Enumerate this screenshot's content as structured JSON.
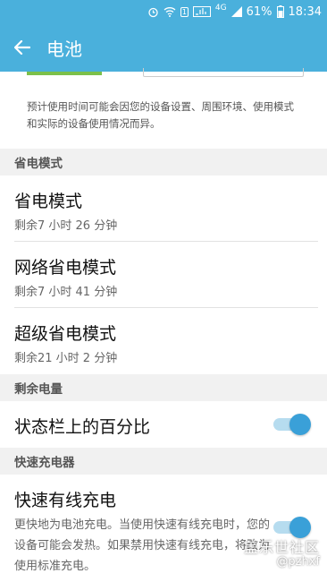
{
  "status_bar": {
    "network_label": "4G",
    "battery_percent": "61%",
    "time": "18:34",
    "sim_label": "1",
    "signal_label": "4G"
  },
  "app_bar": {
    "title": "电池"
  },
  "estimate_note": "预计使用时间可能会因您的设备设置、周围环境、使用模式和实际的设备使用情况而异。",
  "sections": {
    "power_saving": {
      "header": "省电模式",
      "items": [
        {
          "title": "省电模式",
          "subtitle": "剩余7 小时 26 分钟"
        },
        {
          "title": "网络省电模式",
          "subtitle": "剩余7 小时 41 分钟"
        },
        {
          "title": "超级省电模式",
          "subtitle": "剩余21 小时 2 分钟"
        }
      ]
    },
    "remaining": {
      "header": "剩余电量",
      "item": {
        "title": "状态栏上的百分比",
        "toggle_on": true
      }
    },
    "fast_charger": {
      "header": "快速充电器",
      "item": {
        "title": "快速有线充电",
        "description": "更快地为电池充电。当使用快速有线充电时，您的设备可能会发热。如果禁用快速有线充电，将改为使用标准充电。",
        "toggle_on": true
      }
    }
  },
  "watermark": {
    "line1": "盖乐世社区",
    "line2": "@pzhxf"
  },
  "colors": {
    "accent": "#4ab0dc",
    "toggle_knob": "#3aa0d8",
    "toggle_track": "#b6dcef"
  }
}
